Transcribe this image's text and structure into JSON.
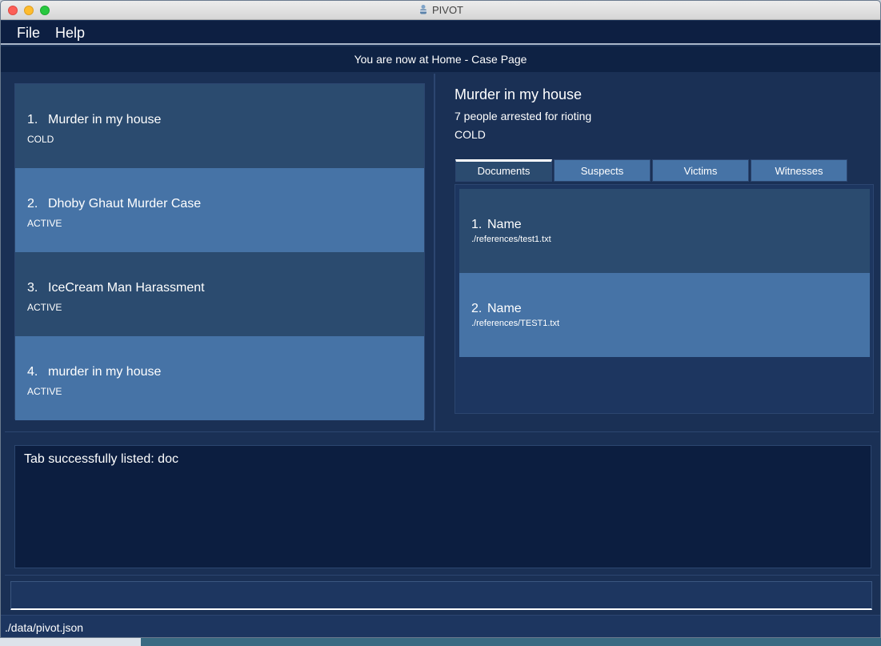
{
  "window": {
    "title": "PIVOT"
  },
  "menu": {
    "file": "File",
    "help": "Help"
  },
  "status_top": "You are now at Home - Case Page",
  "cases": [
    {
      "index": "1.",
      "title": "Murder in my house",
      "status": "COLD"
    },
    {
      "index": "2.",
      "title": "Dhoby Ghaut Murder Case",
      "status": "ACTIVE"
    },
    {
      "index": "3.",
      "title": "IceCream Man Harassment",
      "status": "ACTIVE"
    },
    {
      "index": "4.",
      "title": "murder in my house",
      "status": "ACTIVE"
    }
  ],
  "detail": {
    "title": "Murder in my house",
    "description": "7 people arrested for rioting",
    "status": "COLD"
  },
  "tabs": [
    {
      "label": "Documents"
    },
    {
      "label": "Suspects"
    },
    {
      "label": "Victims"
    },
    {
      "label": "Witnesses"
    }
  ],
  "documents": [
    {
      "index": "1.",
      "name": "Name",
      "path": "./references/test1.txt"
    },
    {
      "index": "2.",
      "name": "Name",
      "path": "./references/TEST1.txt"
    }
  ],
  "result_text": "Tab successfully listed: doc",
  "command": {
    "value": "",
    "placeholder": ""
  },
  "footer": {
    "path": "./data/pivot.json"
  },
  "colors": {
    "window_bg": "#1a3055",
    "item_dark": "#2b4b6f",
    "item_light": "#4673a6",
    "menubar": "#0d1f42"
  }
}
